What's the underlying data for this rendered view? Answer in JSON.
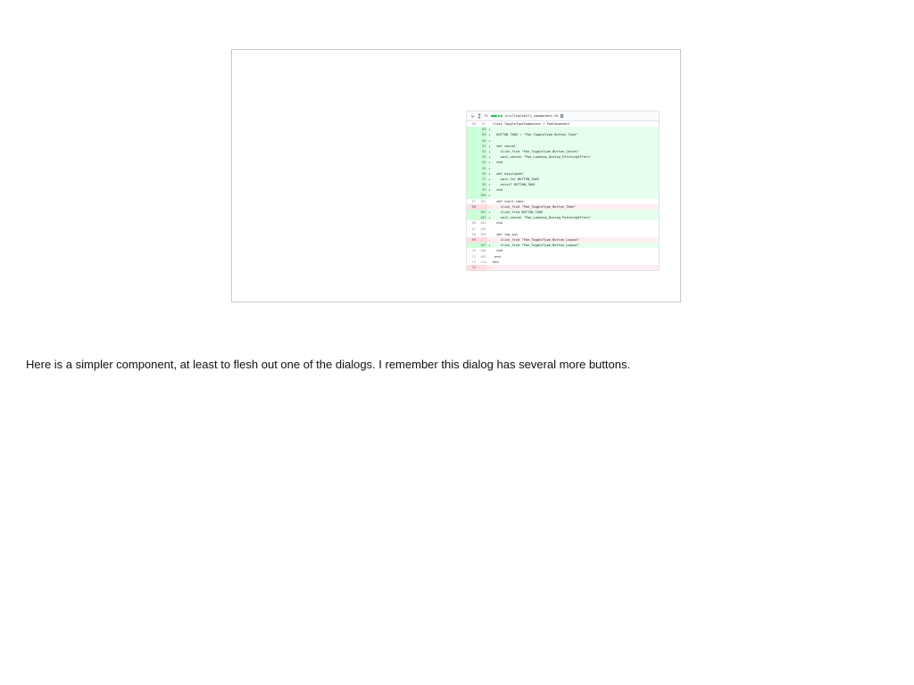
{
  "slide": {
    "diff": {
      "header": {
        "change_count": "71",
        "file_path": "src/lib/skill_component.rb",
        "collapse_icon": "chevron-down-icon",
        "expand_icon": "unfold-icon",
        "copy_icon": "copy-icon",
        "accent_add": "#2cbe4e"
      },
      "lines": [
        {
          "type": "ctx",
          "old": "66",
          "new": "87",
          "marker": "",
          "text": "class ToggleTypeComponent < PoeComponent"
        },
        {
          "type": "add",
          "old": "",
          "new": "88",
          "marker": "+",
          "text": ""
        },
        {
          "type": "add",
          "old": "",
          "new": "89",
          "marker": "+",
          "text": "  BUTTON_TAKE = \"Poe_ToggleType_Button_Take\""
        },
        {
          "type": "add",
          "old": "",
          "new": "90",
          "marker": "+",
          "text": ""
        },
        {
          "type": "add",
          "old": "",
          "new": "91",
          "marker": "+",
          "text": "  def cancel"
        },
        {
          "type": "add",
          "old": "",
          "new": "92",
          "marker": "+",
          "text": "    click_find \"Poe_ToggleType_Button_Cancel\""
        },
        {
          "type": "add",
          "old": "",
          "new": "93",
          "marker": "+",
          "text": "    wait_vanish \"Poe_Loading_Dialog_FetchingOffers\""
        },
        {
          "type": "add",
          "old": "",
          "new": "94",
          "marker": "+",
          "text": "  end"
        },
        {
          "type": "add",
          "old": "",
          "new": "95",
          "marker": "+",
          "text": ""
        },
        {
          "type": "add",
          "old": "",
          "new": "96",
          "marker": "+",
          "text": "  def displayed?"
        },
        {
          "type": "add",
          "old": "",
          "new": "97",
          "marker": "+",
          "text": "    wait_for BUTTON_TAKE"
        },
        {
          "type": "add",
          "old": "",
          "new": "98",
          "marker": "+",
          "text": "    exist? BUTTON_TAKE"
        },
        {
          "type": "add",
          "old": "",
          "new": "99",
          "marker": "+",
          "text": "  end"
        },
        {
          "type": "add",
          "old": "",
          "new": "100",
          "marker": "+",
          "text": ""
        },
        {
          "type": "ctx",
          "old": "67",
          "new": "101",
          "marker": "",
          "text": "  def start_take"
        },
        {
          "type": "del",
          "old": "68",
          "new": "",
          "marker": "-",
          "text": "    click_find \"Poe_ToggleType_Button_Take\""
        },
        {
          "type": "add",
          "old": "",
          "new": "102",
          "marker": "+",
          "text": "    click_find BUTTON_TAKE"
        },
        {
          "type": "add",
          "old": "",
          "new": "103",
          "marker": "+",
          "text": "    wait_vanish \"Poe_Loading_Dialog_FetchingOffers\""
        },
        {
          "type": "ctx",
          "old": "69",
          "new": "104",
          "marker": "",
          "text": "  end"
        },
        {
          "type": "ctx",
          "old": "67",
          "new": "105",
          "marker": "",
          "text": ""
        },
        {
          "type": "ctx",
          "old": "68",
          "new": "106",
          "marker": "",
          "text": "  def log_out"
        },
        {
          "type": "del",
          "old": "69",
          "new": "",
          "marker": "-",
          "text": "    click_find \"Poe_ToggleType_Button_Logout\""
        },
        {
          "type": "add",
          "old": "",
          "new": "107",
          "marker": "+",
          "text": "    click_find \"Poe_ToggleType_Button_Logout\""
        },
        {
          "type": "ctx",
          "old": "70",
          "new": "108",
          "marker": "",
          "text": "  end"
        },
        {
          "type": "ctx",
          "old": "71",
          "new": "109",
          "marker": "",
          "text": " end"
        },
        {
          "type": "ctx",
          "old": "72",
          "new": "110",
          "marker": "",
          "text": "end"
        },
        {
          "type": "del",
          "old": "73",
          "new": "",
          "marker": "-",
          "text": ""
        }
      ]
    }
  },
  "notes": {
    "text": "Here is a simpler component, at least to flesh out one of the dialogs. I remember this dialog has several more buttons."
  }
}
